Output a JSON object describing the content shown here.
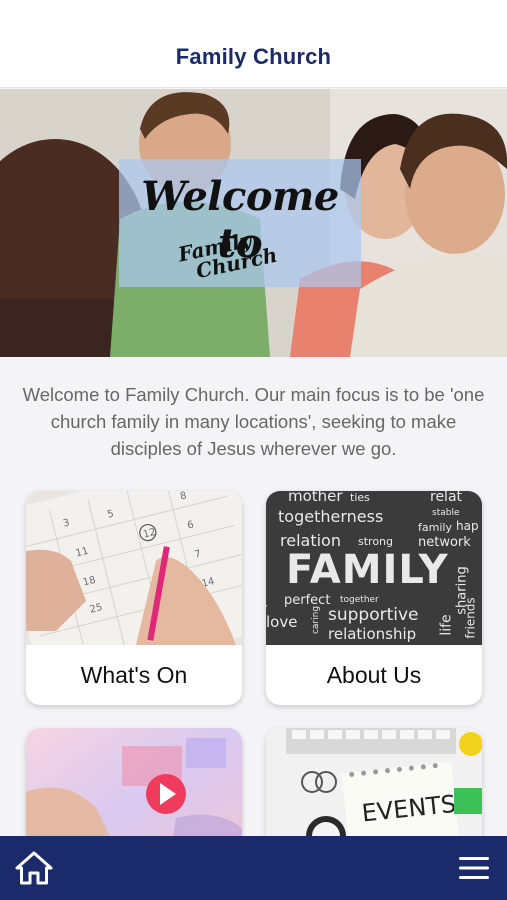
{
  "header": {
    "title": "Family Church"
  },
  "hero": {
    "line1": "Welcome to",
    "line2a": "Family",
    "line2b": "Church"
  },
  "intro": {
    "text": "Welcome to Family Church. Our main focus is to be 'one church family in many locations', seeking to make disciples of Jesus wherever we go."
  },
  "tiles": [
    {
      "label": "What's On",
      "image": "calendar-photo"
    },
    {
      "label": "About Us",
      "image": "family-word-cloud"
    },
    {
      "label": "",
      "image": "video-play-photo"
    },
    {
      "label": "",
      "image": "events-notepad-photo"
    }
  ],
  "word_cloud": {
    "words": [
      "mother",
      "ties",
      "relat",
      "togetherness",
      "stable",
      "family",
      "hap",
      "relation",
      "strong",
      "network",
      "FAMILY",
      "parenthood",
      "perfect",
      "together",
      "supportive",
      "love",
      "relationship",
      "life",
      "sharing",
      "friends",
      "caring"
    ]
  },
  "events_note": "EVENTS",
  "bottom_bar": {
    "home_icon": "home-icon",
    "menu_icon": "hamburger-menu-icon"
  },
  "colors": {
    "brand_navy": "#1b2a6b",
    "background": "#f4f4f6",
    "intro_text": "#676767"
  }
}
